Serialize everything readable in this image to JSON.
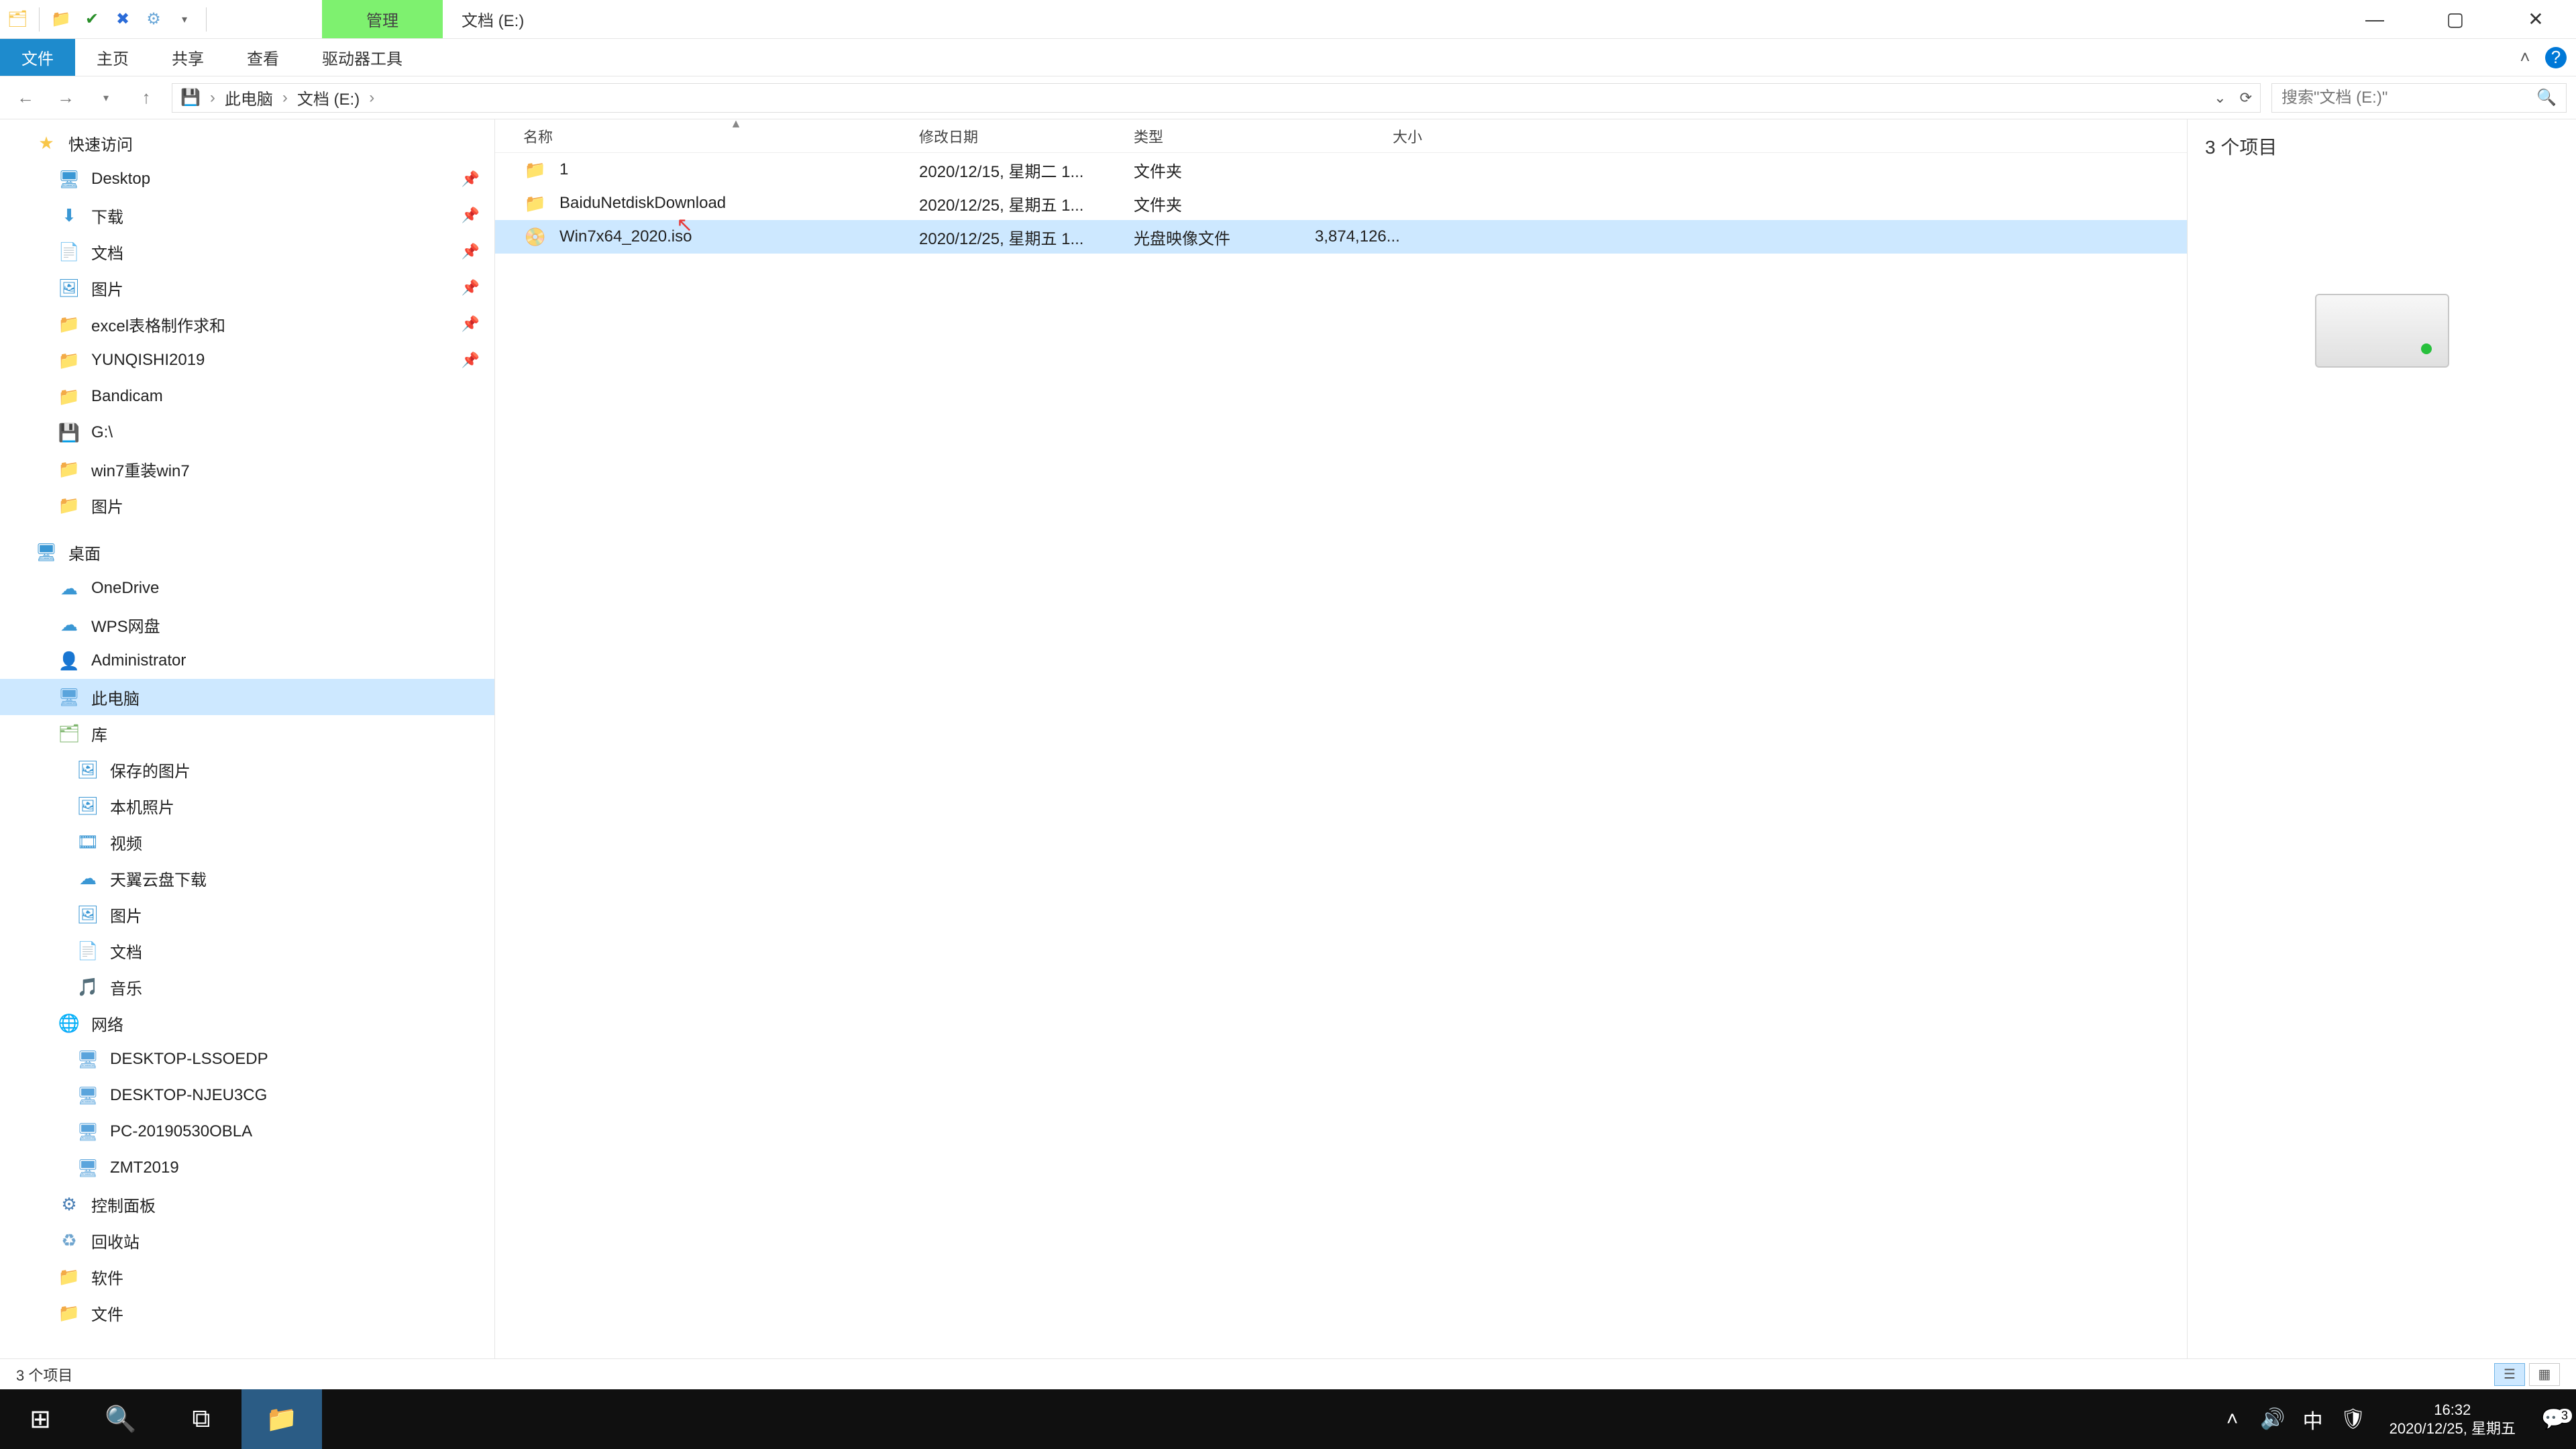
{
  "title": {
    "context_tab": "管理",
    "window_title": "文档 (E:)"
  },
  "ribbon": {
    "tabs": {
      "file": "文件",
      "home": "主页",
      "share": "共享",
      "view": "查看",
      "drive_tools": "驱动器工具"
    }
  },
  "address": {
    "crumbs": [
      "此电脑",
      "文档 (E:)"
    ]
  },
  "search": {
    "placeholder": "搜索\"文档 (E:)\""
  },
  "nav": {
    "quick_access": "快速访问",
    "qa_items": [
      {
        "label": "Desktop"
      },
      {
        "label": "下载"
      },
      {
        "label": "文档"
      },
      {
        "label": "图片"
      },
      {
        "label": "excel表格制作求和"
      },
      {
        "label": "YUNQISHI2019"
      },
      {
        "label": "Bandicam"
      },
      {
        "label": "G:\\"
      },
      {
        "label": "win7重装win7"
      },
      {
        "label": "图片"
      }
    ],
    "desktop": "桌面",
    "desk_items": [
      {
        "label": "OneDrive",
        "kind": "cloud"
      },
      {
        "label": "WPS网盘",
        "kind": "cloud"
      },
      {
        "label": "Administrator",
        "kind": "user"
      },
      {
        "label": "此电脑",
        "kind": "pc",
        "selected": true
      },
      {
        "label": "库",
        "kind": "lib"
      }
    ],
    "lib_items": [
      {
        "label": "保存的图片"
      },
      {
        "label": "本机照片"
      },
      {
        "label": "视频"
      },
      {
        "label": "天翼云盘下载"
      },
      {
        "label": "图片"
      },
      {
        "label": "文档"
      },
      {
        "label": "音乐"
      }
    ],
    "network": "网络",
    "net_items": [
      {
        "label": "DESKTOP-LSSOEDP"
      },
      {
        "label": "DESKTOP-NJEU3CG"
      },
      {
        "label": "PC-20190530OBLA"
      },
      {
        "label": "ZMT2019"
      }
    ],
    "control_panel": "控制面板",
    "recycle": "回收站",
    "software": "软件",
    "docs": "文件"
  },
  "columns": {
    "name": "名称",
    "date": "修改日期",
    "type": "类型",
    "size": "大小"
  },
  "files": [
    {
      "name": "1",
      "date": "2020/12/15, 星期二 1...",
      "type": "文件夹",
      "size": "",
      "icon": "folder"
    },
    {
      "name": "BaiduNetdiskDownload",
      "date": "2020/12/25, 星期五 1...",
      "type": "文件夹",
      "size": "",
      "icon": "folder"
    },
    {
      "name": "Win7x64_2020.iso",
      "date": "2020/12/25, 星期五 1...",
      "type": "光盘映像文件",
      "size": "3,874,126...",
      "icon": "iso",
      "selected": true
    }
  ],
  "preview": {
    "summary": "3 个项目"
  },
  "status": {
    "text": "3 个项目"
  },
  "taskbar": {
    "time": "16:32",
    "date": "2020/12/25, 星期五",
    "ime": "中",
    "notif_count": "3"
  }
}
